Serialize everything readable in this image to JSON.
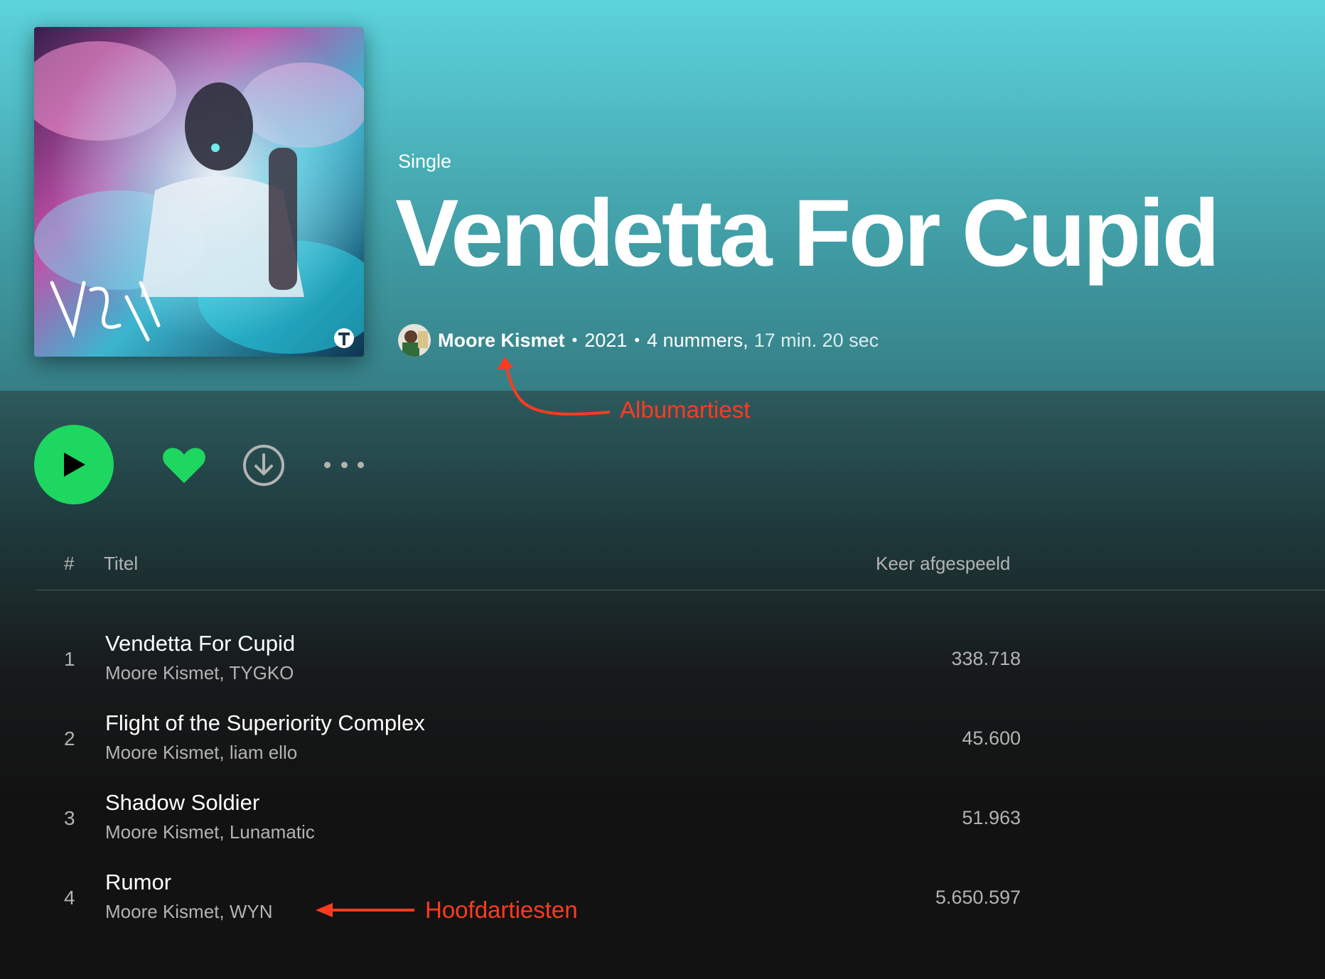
{
  "album": {
    "type": "Single",
    "title": "Vendetta For Cupid",
    "artist": "Moore Kismet",
    "year": "2021",
    "track_count": "4 nummers,",
    "duration": "17 min. 20 sec",
    "separator": "•"
  },
  "table": {
    "hash": "#",
    "title_header": "Titel",
    "plays_header": "Keer afgespeeld"
  },
  "tracks": [
    {
      "num": "1",
      "title": "Vendetta For Cupid",
      "artists": "Moore Kismet, TYGKO",
      "plays": "338.718"
    },
    {
      "num": "2",
      "title": "Flight of the Superiority Complex",
      "artists": "Moore Kismet, liam ello",
      "plays": "45.600"
    },
    {
      "num": "3",
      "title": "Shadow Soldier",
      "artists": "Moore Kismet, Lunamatic",
      "plays": "51.963"
    },
    {
      "num": "4",
      "title": "Rumor",
      "artists": "Moore Kismet, WYN",
      "plays": "5.650.597"
    }
  ],
  "annotations": {
    "album_artist": "Albumartiest",
    "main_artists": "Hoofdartiesten"
  },
  "icons": {
    "play": "play-icon",
    "heart": "heart-icon",
    "download": "download-icon",
    "more": "more-icon"
  },
  "colors": {
    "accent_green": "#1ed760",
    "hero_teal": "#4fb9c2",
    "annotation_red": "#ff3b1f",
    "background": "#121212"
  }
}
